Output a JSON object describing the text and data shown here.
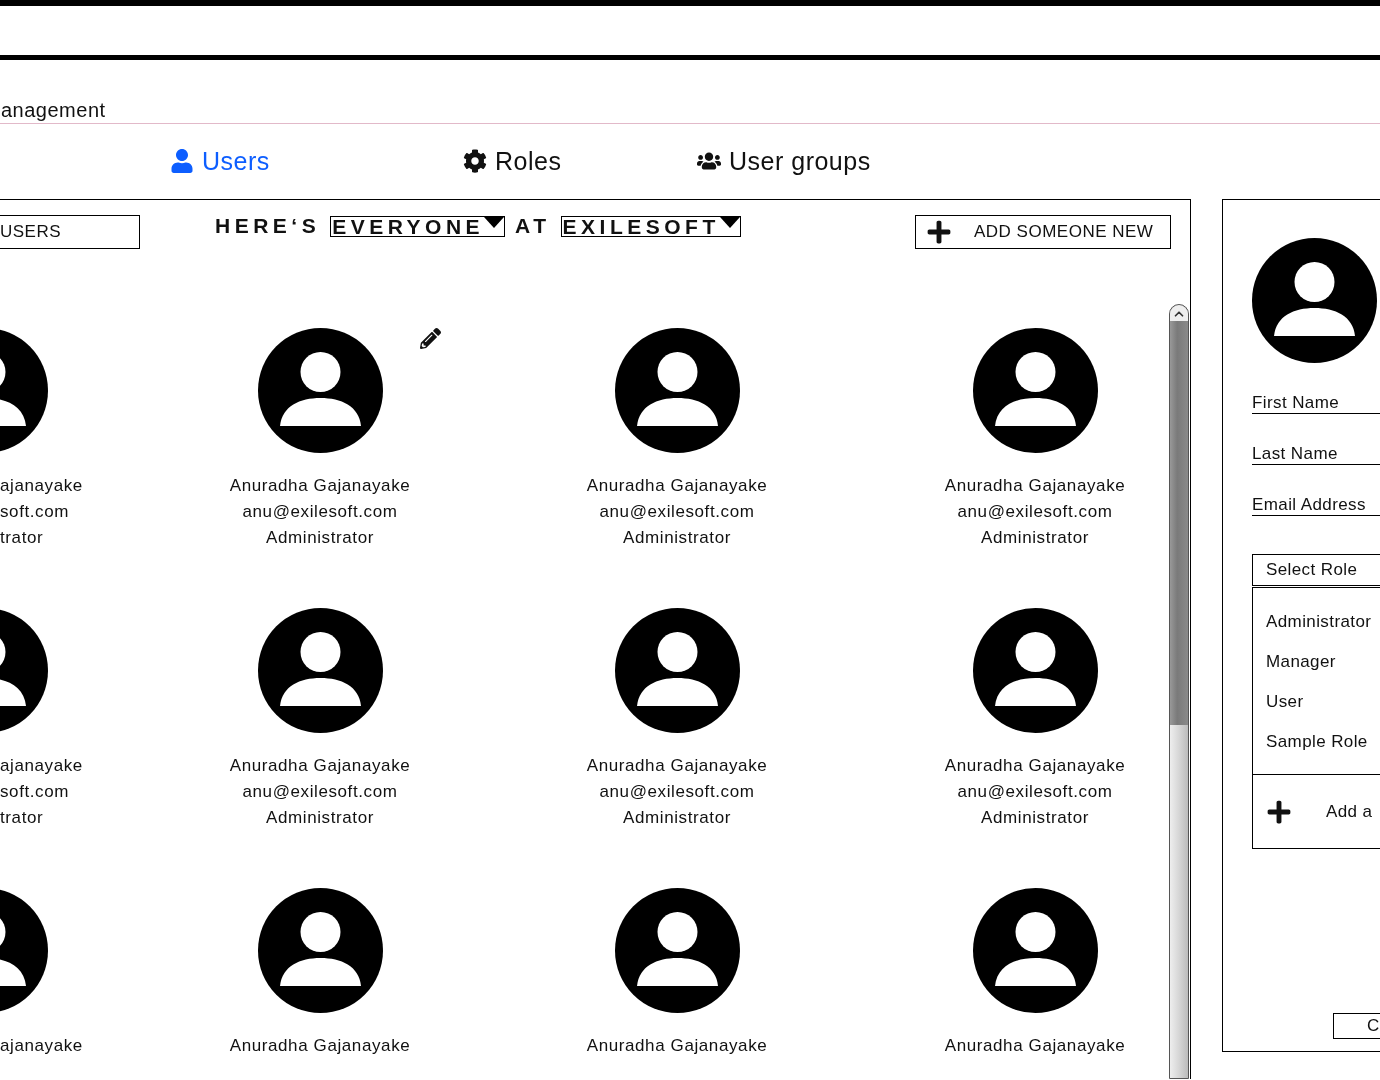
{
  "header": {
    "title": "anagement"
  },
  "tabs": [
    {
      "label": "Users",
      "selected": true
    },
    {
      "label": "Roles",
      "selected": false
    },
    {
      "label": "User groups",
      "selected": false
    }
  ],
  "users_panel": {
    "search": {
      "value": "USERS"
    },
    "heading": {
      "prefix": "HERE‘S",
      "scope": "EVERYONE",
      "connector": "AT",
      "organization": "EXILESOFT"
    },
    "add_button": "ADD SOMEONE NEW",
    "rows": [
      [
        {
          "kind": "clipped",
          "name": "ajanayake",
          "email": "soft.com",
          "role": "trator",
          "edit_icon": false
        },
        {
          "kind": "full",
          "name": "Anuradha Gajanayake",
          "email": "anu@exilesoft.com",
          "role": "Administrator",
          "edit_icon": true
        },
        {
          "kind": "full",
          "name": "Anuradha Gajanayake",
          "email": "anu@exilesoft.com",
          "role": "Administrator",
          "edit_icon": false
        },
        {
          "kind": "full",
          "name": "Anuradha Gajanayake",
          "email": "anu@exilesoft.com",
          "role": "Administrator",
          "edit_icon": false
        }
      ],
      [
        {
          "kind": "clipped",
          "name": "ajanayake",
          "email": "soft.com",
          "role": "trator",
          "edit_icon": false
        },
        {
          "kind": "full",
          "name": "Anuradha Gajanayake",
          "email": "anu@exilesoft.com",
          "role": "Administrator",
          "edit_icon": false
        },
        {
          "kind": "full",
          "name": "Anuradha Gajanayake",
          "email": "anu@exilesoft.com",
          "role": "Administrator",
          "edit_icon": false
        },
        {
          "kind": "full",
          "name": "Anuradha Gajanayake",
          "email": "anu@exilesoft.com",
          "role": "Administrator",
          "edit_icon": false
        }
      ],
      [
        {
          "kind": "clipped",
          "name": "ajanayake",
          "edit_icon": false
        },
        {
          "kind": "full",
          "name": "Anuradha Gajanayake",
          "edit_icon": false
        },
        {
          "kind": "full",
          "name": "Anuradha Gajanayake",
          "edit_icon": false
        },
        {
          "kind": "full",
          "name": "Anuradha Gajanayake",
          "edit_icon": false
        }
      ]
    ]
  },
  "form_panel": {
    "fields": [
      {
        "label": "First Name"
      },
      {
        "label": "Last Name"
      },
      {
        "label": "Email Address"
      }
    ],
    "role_select": {
      "placeholder": "Select Role",
      "options": [
        "Administrator",
        "Manager",
        "User",
        "Sample Role"
      ],
      "add_label": "Add a"
    },
    "button": "C"
  }
}
